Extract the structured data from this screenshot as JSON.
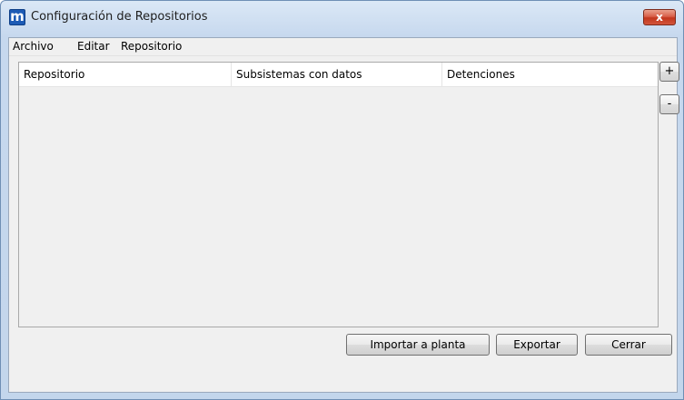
{
  "window": {
    "title": "Configuración de Repositorios",
    "app_icon": "m",
    "close_glyph": "x"
  },
  "menu": {
    "items": [
      {
        "label": "Archivo"
      },
      {
        "label": "Editar"
      },
      {
        "label": "Repositorio"
      }
    ]
  },
  "table": {
    "columns": [
      {
        "label": "Repositorio"
      },
      {
        "label": "Subsistemas con datos"
      },
      {
        "label": "Detenciones"
      }
    ],
    "rows": []
  },
  "side_buttons": {
    "add_label": "+",
    "remove_label": "-"
  },
  "actions": {
    "import_label": "Importar a planta",
    "export_label": "Exportar",
    "close_label": "Cerrar"
  },
  "colors": {
    "title_bar": "#c6d8ee",
    "close_button": "#d2553b",
    "app_icon": "#1d5bb5",
    "dialog_background": "#f0f0f0"
  }
}
